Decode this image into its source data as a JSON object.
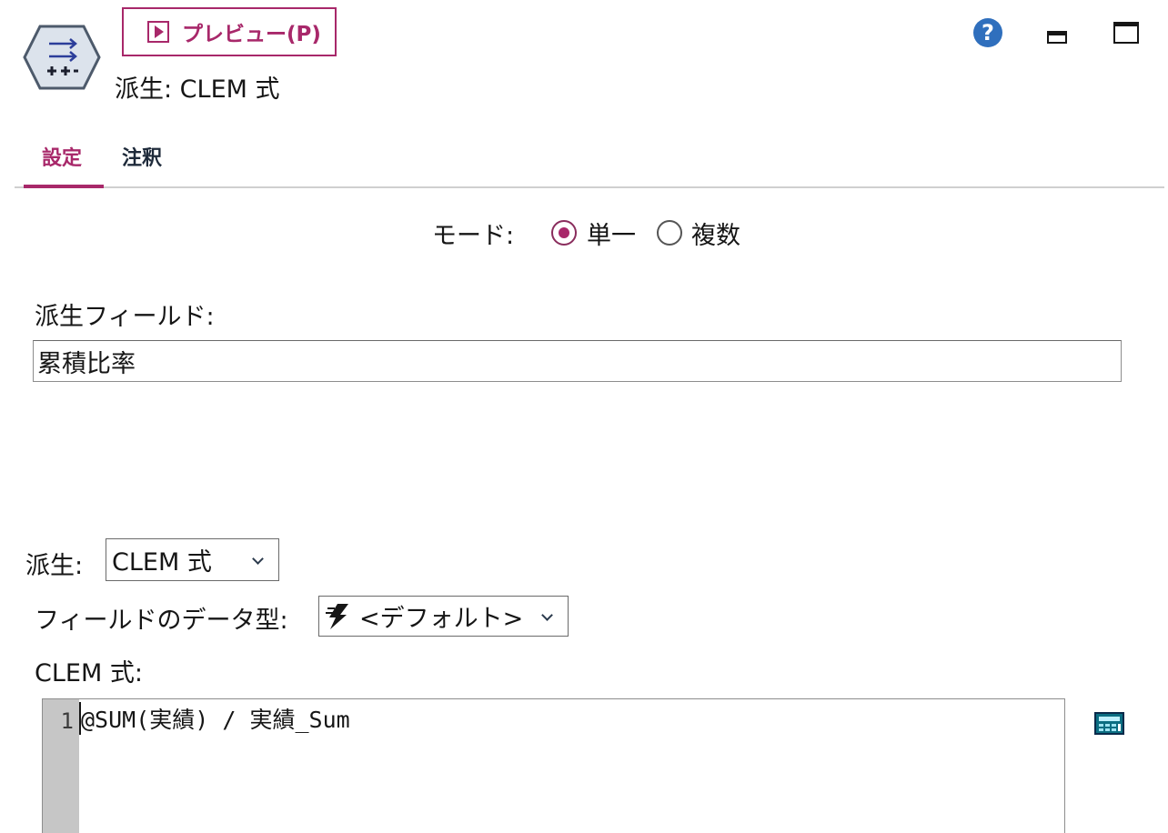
{
  "header": {
    "preview_label": "プレビュー(P)",
    "node_title": "派生: CLEM 式",
    "node_icon": "derive-node-icon",
    "help_icon": "help-icon",
    "minimize_icon": "minimize-icon",
    "maximize_icon": "maximize-icon",
    "accent_color": "#a8286a"
  },
  "tabs": [
    {
      "label": "設定",
      "active": true
    },
    {
      "label": "注釈",
      "active": false
    }
  ],
  "mode": {
    "label": "モード:",
    "options": [
      {
        "label": "単一",
        "selected": true
      },
      {
        "label": "複数",
        "selected": false
      }
    ]
  },
  "derive_field": {
    "label": "派生フィールド:",
    "value": "累積比率"
  },
  "derive_as": {
    "label": "派生:",
    "selected": "CLEM 式"
  },
  "field_type": {
    "label": "フィールドのデータ型:",
    "selected": "<デフォルト>",
    "icon": "lightning-icon"
  },
  "clem": {
    "label": "CLEM 式:",
    "line_number": "1",
    "expression": "@SUM(実績) / 実績_Sum",
    "builder_icon": "calculator-icon"
  }
}
